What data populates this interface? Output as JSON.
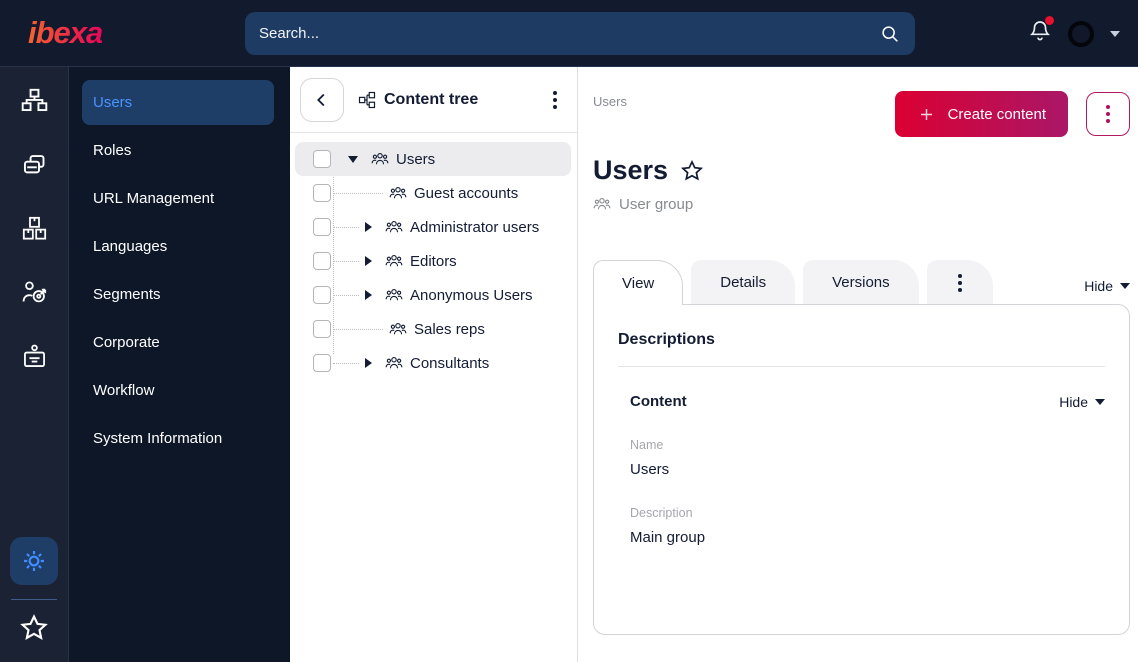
{
  "brand": {
    "logo_text": "ibexa"
  },
  "topbar": {
    "search_placeholder": "Search...",
    "notification_badge_visible": true
  },
  "rail": {
    "top_icons": [
      {
        "icon": "sitemap-icon"
      },
      {
        "icon": "content-pages-icon"
      },
      {
        "icon": "product-boxes-icon"
      },
      {
        "icon": "personalization-target-icon"
      },
      {
        "icon": "id-badge-icon"
      }
    ],
    "bottom_icons": [
      {
        "icon": "gear-icon",
        "active": true
      },
      {
        "icon": "star-icon"
      }
    ]
  },
  "sidebar": {
    "items": [
      {
        "label": "Users",
        "active": true
      },
      {
        "label": "Roles"
      },
      {
        "label": "URL Management"
      },
      {
        "label": "Languages"
      },
      {
        "label": "Segments"
      },
      {
        "label": "Corporate"
      },
      {
        "label": "Workflow"
      },
      {
        "label": "System Information"
      }
    ]
  },
  "content_tree": {
    "title": "Content tree",
    "items": [
      {
        "label": "Users",
        "expander": "expanded",
        "selected": true,
        "level": 0
      },
      {
        "label": "Guest accounts",
        "expander": "none",
        "level": 1
      },
      {
        "label": "Administrator users",
        "expander": "collapsed",
        "level": 1
      },
      {
        "label": "Editors",
        "expander": "collapsed",
        "level": 1
      },
      {
        "label": "Anonymous Users",
        "expander": "collapsed",
        "level": 1
      },
      {
        "label": "Sales reps",
        "expander": "none",
        "level": 1
      },
      {
        "label": "Consultants",
        "expander": "collapsed",
        "level": 1
      }
    ]
  },
  "main": {
    "breadcrumb": "Users",
    "create_button_label": "Create content",
    "title": "Users",
    "content_type": "User group",
    "tabs": [
      {
        "label": "View",
        "active": true
      },
      {
        "label": "Details"
      },
      {
        "label": "Versions"
      }
    ],
    "tabs_hide_label": "Hide",
    "card": {
      "heading": "Descriptions",
      "section_title": "Content",
      "section_hide_label": "Hide",
      "fields": [
        {
          "label": "Name",
          "value": "Users"
        },
        {
          "label": "Description",
          "value": "Main group"
        }
      ]
    }
  },
  "colors": {
    "topbar_bg": "#121a2e",
    "sidebar_bg": "#0e1728",
    "accent_blue": "#4b93ff",
    "selected_navy": "#1e3e68",
    "brand_gradient_start": "#db0032",
    "brand_gradient_end": "#aa1767",
    "notification_badge": "#e8112d"
  }
}
